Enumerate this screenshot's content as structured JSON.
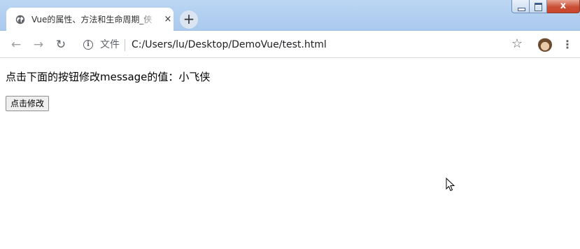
{
  "tab": {
    "title": "Vue的属性、方法和生命周期_侠",
    "close_icon": "×",
    "globe_icon": "globe-icon"
  },
  "new_tab": {
    "label": "+"
  },
  "window_controls": {
    "close_symbol": "x"
  },
  "toolbar": {
    "back_icon": "←",
    "forward_icon": "→",
    "reload_icon": "↻",
    "info_icon": "i",
    "file_label": "文件",
    "url": "C:/Users/lu/Desktop/DemoVue/test.html",
    "star_icon": "☆",
    "menu_icon": "⋮"
  },
  "page": {
    "message_line": "点击下面的按钮修改message的值：小飞侠",
    "button_label": "点击修改"
  },
  "colors": {
    "titlebar": "#bcd6f3",
    "close_button": "#c94f35"
  }
}
